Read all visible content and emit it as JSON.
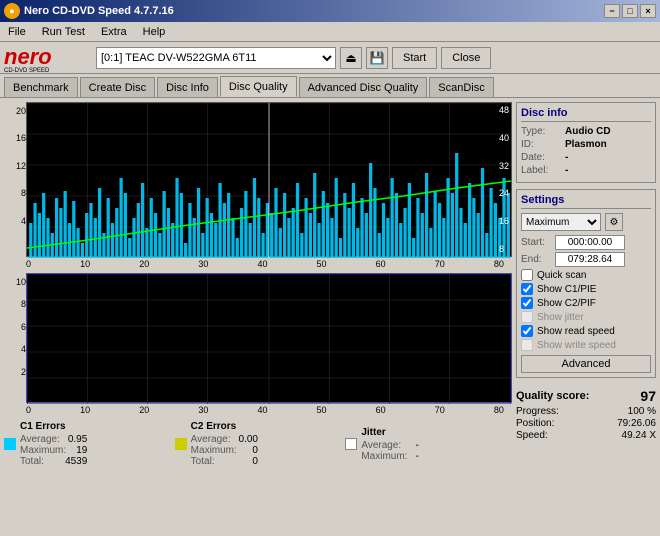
{
  "titlebar": {
    "title": "Nero CD-DVD Speed 4.7.7.16",
    "icon": "●",
    "buttons": [
      "−",
      "□",
      "×"
    ]
  },
  "menubar": {
    "items": [
      "File",
      "Run Test",
      "Extra",
      "Help"
    ]
  },
  "toolbar": {
    "drive_label": "[0:1]  TEAC DV-W522GMA 6T11",
    "start_label": "Start",
    "close_label": "Close"
  },
  "tabs": [
    {
      "label": "Benchmark"
    },
    {
      "label": "Create Disc"
    },
    {
      "label": "Disc Info"
    },
    {
      "label": "Disc Quality",
      "active": true
    },
    {
      "label": "Advanced Disc Quality"
    },
    {
      "label": "ScanDisc"
    }
  ],
  "disc_info": {
    "section_title": "Disc info",
    "type_label": "Type:",
    "type_value": "Audio CD",
    "id_label": "ID:",
    "id_value": "Plasmon",
    "date_label": "Date:",
    "date_value": "-",
    "label_label": "Label:",
    "label_value": "-"
  },
  "settings": {
    "section_title": "Settings",
    "speed_value": "Maximum",
    "start_label": "Start:",
    "start_value": "000:00.00",
    "end_label": "End:",
    "end_value": "079:28.64",
    "quickscan_label": "Quick scan",
    "c1pie_label": "Show C1/PIE",
    "c2pif_label": "Show C2/PIF",
    "jitter_label": "Show jitter",
    "readspeed_label": "Show read speed",
    "writespeed_label": "Show write speed",
    "advanced_label": "Advanced",
    "quickscan_checked": false,
    "c1pie_checked": true,
    "c2pif_checked": true,
    "jitter_checked": false,
    "readspeed_checked": true,
    "writespeed_checked": false
  },
  "quality": {
    "score_label": "Quality score:",
    "score_value": "97"
  },
  "progress": {
    "progress_label": "Progress:",
    "progress_value": "100 %",
    "position_label": "Position:",
    "position_value": "79:26.06",
    "speed_label": "Speed:",
    "speed_value": "49.24 X"
  },
  "legend": {
    "c1": {
      "label": "C1 Errors",
      "avg_label": "Average:",
      "avg_value": "0.95",
      "max_label": "Maximum:",
      "max_value": "19",
      "total_label": "Total:",
      "total_value": "4539",
      "color": "#00ffff"
    },
    "c2": {
      "label": "C2 Errors",
      "avg_label": "Average:",
      "avg_value": "0.00",
      "max_label": "Maximum:",
      "max_value": "0",
      "total_label": "Total:",
      "total_value": "0",
      "color": "#ffff00"
    },
    "jitter": {
      "label": "Jitter",
      "avg_label": "Average:",
      "avg_value": "-",
      "max_label": "Maximum:",
      "max_value": "-",
      "color": "#ffffff"
    }
  },
  "chart_top": {
    "y_right": [
      "48",
      "40",
      "32",
      "24",
      "16",
      "8"
    ],
    "y_left": [
      "20",
      "16",
      "12",
      "8",
      "4"
    ],
    "x_labels": [
      "0",
      "10",
      "20",
      "30",
      "40",
      "50",
      "60",
      "70",
      "80"
    ]
  },
  "chart_bottom": {
    "y_left": [
      "10",
      "8",
      "6",
      "4",
      "2"
    ],
    "x_labels": [
      "0",
      "10",
      "20",
      "30",
      "40",
      "50",
      "60",
      "70",
      "80"
    ]
  }
}
